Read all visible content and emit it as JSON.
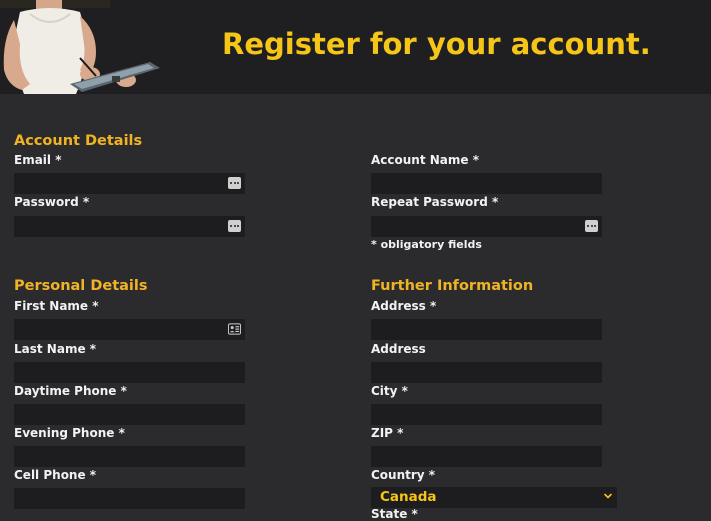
{
  "header": {
    "title": "Register for your account."
  },
  "account_details": {
    "heading": "Account Details",
    "email_label": "Email *",
    "password_label": "Password *",
    "account_name_label": "Account Name *",
    "repeat_password_label": "Repeat Password *",
    "required_note": "* obligatory fields"
  },
  "personal_details": {
    "heading": "Personal Details",
    "first_name_label": "First Name *",
    "last_name_label": "Last Name *",
    "daytime_phone_label": "Daytime Phone *",
    "evening_phone_label": "Evening Phone *",
    "cell_phone_label": "Cell Phone *"
  },
  "further_information": {
    "heading": "Further Information",
    "address1_label": "Address *",
    "address2_label": "Address",
    "city_label": "City *",
    "zip_label": "ZIP *",
    "country_label": "Country *",
    "country_value": "Canada",
    "state_label": "State *"
  },
  "icons": {
    "password_manager": "ellipsis-key-icon",
    "contact_card": "contact-card-icon",
    "dropdown": "chevron-down-icon"
  },
  "colors": {
    "page_background": "#2b2b2d",
    "banner_background": "#1f1f21",
    "accent": "#f5c518",
    "section_heading": "#f0b323",
    "input_background": "#1d1d1f",
    "label_text": "#f2f2f2"
  }
}
